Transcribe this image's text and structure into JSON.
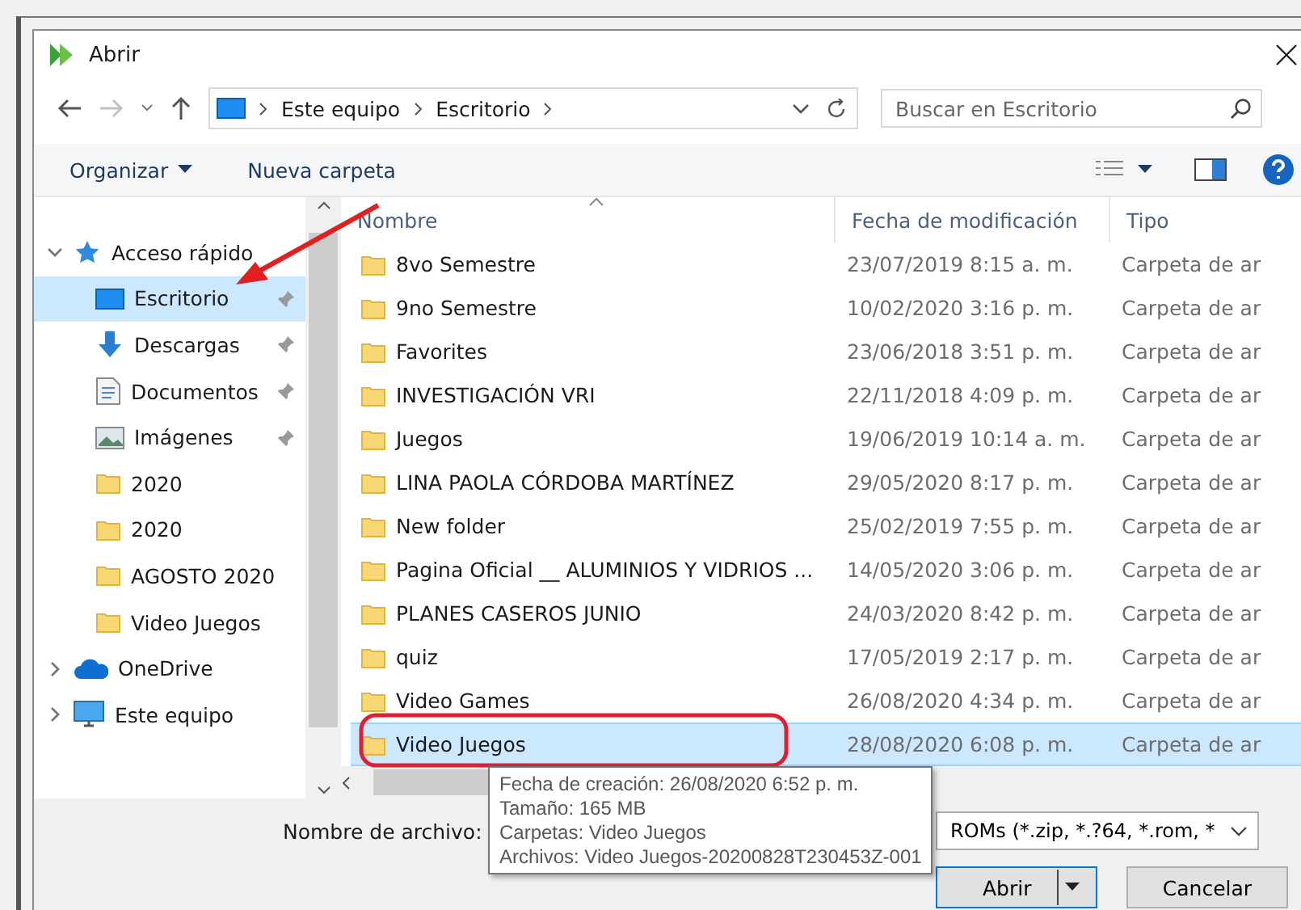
{
  "window": {
    "title": "Abrir"
  },
  "address": {
    "path": [
      "Este equipo",
      "Escritorio"
    ],
    "search_placeholder": "Buscar en Escritorio"
  },
  "toolbar": {
    "organize": "Organizar",
    "new_folder": "Nueva carpeta"
  },
  "sidebar": {
    "items": [
      {
        "label": "Acceso rápido",
        "kind": "star",
        "expanded": true,
        "selected": false,
        "children": [
          {
            "label": "Escritorio",
            "kind": "desktop",
            "pinned": true,
            "selected": true
          },
          {
            "label": "Descargas",
            "kind": "download",
            "pinned": true,
            "selected": false
          },
          {
            "label": "Documentos",
            "kind": "document",
            "pinned": true,
            "selected": false
          },
          {
            "label": "Imágenes",
            "kind": "image",
            "pinned": true,
            "selected": false
          },
          {
            "label": "2020",
            "kind": "folder",
            "pinned": false,
            "selected": false
          },
          {
            "label": "2020",
            "kind": "folder",
            "pinned": false,
            "selected": false
          },
          {
            "label": "AGOSTO 2020",
            "kind": "folder",
            "pinned": false,
            "selected": false
          },
          {
            "label": "Video Juegos",
            "kind": "folder",
            "pinned": false,
            "selected": false
          }
        ]
      },
      {
        "label": "OneDrive",
        "kind": "cloud",
        "expanded": false,
        "selected": false
      },
      {
        "label": "Este equipo",
        "kind": "computer",
        "expanded": false,
        "selected": false
      }
    ]
  },
  "table": {
    "columns": [
      "Nombre",
      "Fecha de modificación",
      "Tipo"
    ],
    "rows": [
      {
        "name": "8vo Semestre",
        "date": "23/07/2019 8:15 a. m.",
        "type": "Carpeta de ar",
        "selected": false
      },
      {
        "name": "9no Semestre",
        "date": "10/02/2020 3:16 p. m.",
        "type": "Carpeta de ar",
        "selected": false
      },
      {
        "name": "Favorites",
        "date": "23/06/2018 3:51 p. m.",
        "type": "Carpeta de ar",
        "selected": false
      },
      {
        "name": "INVESTIGACIÓN VRI",
        "date": "22/11/2018 4:09 p. m.",
        "type": "Carpeta de ar",
        "selected": false
      },
      {
        "name": "Juegos",
        "date": "19/06/2019 10:14 a. m.",
        "type": "Carpeta de ar",
        "selected": false
      },
      {
        "name": "LINA PAOLA CÓRDOBA MARTÍNEZ",
        "date": "29/05/2020 8:17 p. m.",
        "type": "Carpeta de ar",
        "selected": false
      },
      {
        "name": "New folder",
        "date": "25/02/2019 7:55 p. m.",
        "type": "Carpeta de ar",
        "selected": false
      },
      {
        "name": "Pagina Oficial __ ALUMINIOS Y VIDRIOS ...",
        "date": "14/05/2020 3:06 p. m.",
        "type": "Carpeta de ar",
        "selected": false
      },
      {
        "name": "PLANES CASEROS JUNIO",
        "date": "24/03/2020 8:42 p. m.",
        "type": "Carpeta de ar",
        "selected": false
      },
      {
        "name": "quiz",
        "date": "17/05/2019 2:17 p. m.",
        "type": "Carpeta de ar",
        "selected": false
      },
      {
        "name": "Video Games",
        "date": "26/08/2020 4:34 p. m.",
        "type": "Carpeta de ar",
        "selected": false
      },
      {
        "name": "Video Juegos",
        "date": "28/08/2020 6:08 p. m.",
        "type": "Carpeta de ar",
        "selected": true
      }
    ]
  },
  "tooltip": [
    "Fecha de creación: 26/08/2020 6:52 p. m.",
    "Tamaño: 165 MB",
    "Carpetas: Video Juegos",
    "Archivos: Video Juegos-20200828T230453Z-001"
  ],
  "footer": {
    "filename_label": "Nombre de archivo:",
    "filter": "ROMs (*.zip, *.?64, *.rom, *",
    "open": "Abrir",
    "cancel": "Cancelar"
  }
}
